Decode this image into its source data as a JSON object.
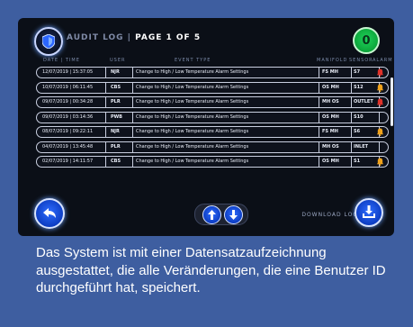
{
  "header": {
    "title_prefix": "AUDIT LOG | ",
    "title_page": "PAGE 1 OF 5",
    "alarm_count": "0"
  },
  "columns": {
    "date_time": "DATE | TIME",
    "user": "USER",
    "event_type": "EVENT TYPE",
    "manifold": "MANIFOLD",
    "sensor": "SENSOR",
    "alarm": "ALARM"
  },
  "rows": [
    {
      "datetime": "12/07/2019  |  15:37:05",
      "user": "NJR",
      "event": "Change to High / Low Temperature Alarm Settings",
      "manifold": "FS MH",
      "sensor": "S7",
      "alarm": true
    },
    {
      "datetime": "10/07/2019  |  06:11:45",
      "user": "CBS",
      "event": "Change to High / Low Temperature Alarm Settings",
      "manifold": "OS MH",
      "sensor": "S12",
      "alarm": true
    },
    {
      "datetime": "09/07/2019  |  00:34:28",
      "user": "PLR",
      "event": "Change to High / Low Temperature Alarm Settings",
      "manifold": "MH OS",
      "sensor": "OUTLET",
      "alarm": true
    },
    {
      "datetime": "09/07/2019  |  03:14:36",
      "user": "PWB",
      "event": "Change to High / Low Temperature Alarm Settings",
      "manifold": "OS MH",
      "sensor": "S10",
      "alarm": false
    },
    {
      "datetime": "08/07/2019  |  09:22:11",
      "user": "NJR",
      "event": "Change to High / Low Temperature Alarm Settings",
      "manifold": "FS MH",
      "sensor": "S6",
      "alarm": true
    },
    {
      "datetime": "04/07/2019  |  13:45:48",
      "user": "PLR",
      "event": "Change to High / Low Temperature Alarm Settings",
      "manifold": "MH OS",
      "sensor": "INLET",
      "alarm": false
    },
    {
      "datetime": "02/07/2019  |  14:11:57",
      "user": "CBS",
      "event": "Change to High / Low Temperature Alarm Settings",
      "manifold": "OS MH",
      "sensor": "S1",
      "alarm": true
    }
  ],
  "footer": {
    "download_label": "DOWNLOAD LOG"
  },
  "caption": "Das System ist mit einer Datensatzaufzeichnung ausgestattet, die alle Veränderungen, die eine Benutzer ID durchgeführt hat, speichert.",
  "colors": {
    "background": "#3e5ea0",
    "screen": "#0b0f17",
    "alarm_bell": "#f0a31c",
    "alarm_bell_red": "#e0322a",
    "status_green": "#1fd35a",
    "button_blue": "#1f56e0"
  },
  "icons": {
    "header_left": "shield-icon",
    "back": "back-arrow-icon",
    "page_up": "arrow-up-icon",
    "page_down": "arrow-down-icon",
    "download": "download-icon",
    "alarm": "bell-icon"
  }
}
